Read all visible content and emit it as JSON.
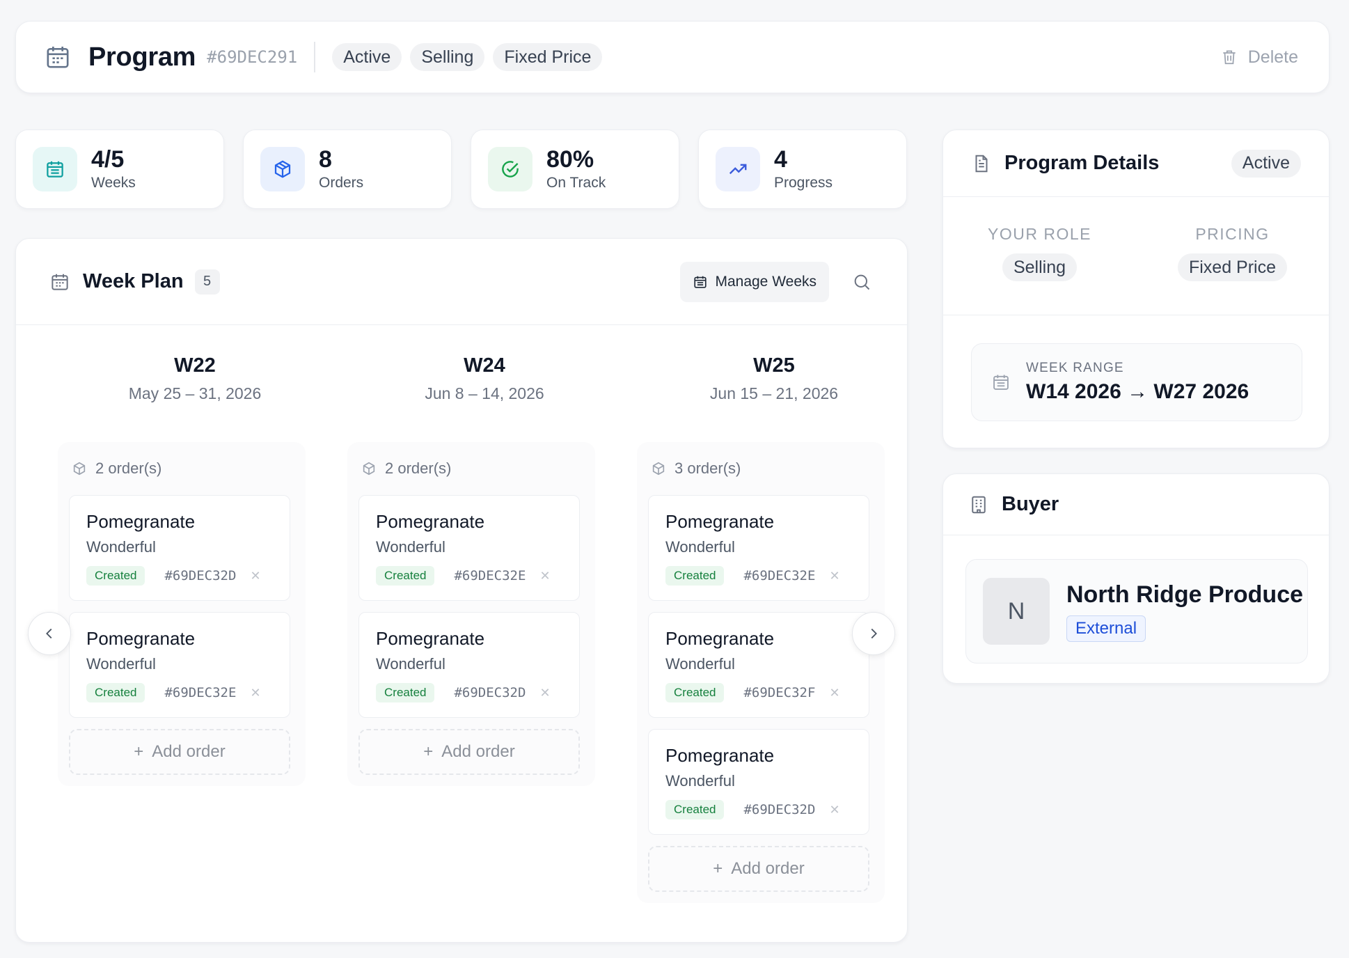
{
  "header": {
    "title": "Program",
    "code": "#69DEC291",
    "tags": [
      "Active",
      "Selling",
      "Fixed Price"
    ],
    "delete_label": "Delete"
  },
  "stats": [
    {
      "value": "4/5",
      "label": "Weeks",
      "icon": "calendar-icon",
      "color": "#0f9f9f",
      "bg": "#e6f7f6"
    },
    {
      "value": "8",
      "label": "Orders",
      "icon": "box-icon",
      "color": "#2563eb",
      "bg": "#e9f0fd"
    },
    {
      "value": "80%",
      "label": "On Track",
      "icon": "check-circle-icon",
      "color": "#16a34a",
      "bg": "#eaf7ee"
    },
    {
      "value": "4",
      "label": "Progress",
      "icon": "trending-up-icon",
      "color": "#3b5bdb",
      "bg": "#edf1fd"
    }
  ],
  "week_plan": {
    "title": "Week Plan",
    "count": "5",
    "manage_label": "Manage Weeks",
    "add_label": "Add order",
    "weeks": [
      {
        "week": "W22",
        "dates": "May 25 – 31, 2026",
        "order_count": "2 order(s)",
        "orders": [
          {
            "product": "Pomegranate",
            "variety": "Wonderful",
            "status": "Created",
            "id": "#69DEC32D"
          },
          {
            "product": "Pomegranate",
            "variety": "Wonderful",
            "status": "Created",
            "id": "#69DEC32E"
          }
        ]
      },
      {
        "week": "W24",
        "dates": "Jun 8 – 14, 2026",
        "order_count": "2 order(s)",
        "orders": [
          {
            "product": "Pomegranate",
            "variety": "Wonderful",
            "status": "Created",
            "id": "#69DEC32E"
          },
          {
            "product": "Pomegranate",
            "variety": "Wonderful",
            "status": "Created",
            "id": "#69DEC32D"
          }
        ]
      },
      {
        "week": "W25",
        "dates": "Jun 15 – 21, 2026",
        "order_count": "3 order(s)",
        "orders": [
          {
            "product": "Pomegranate",
            "variety": "Wonderful",
            "status": "Created",
            "id": "#69DEC32E"
          },
          {
            "product": "Pomegranate",
            "variety": "Wonderful",
            "status": "Created",
            "id": "#69DEC32F"
          },
          {
            "product": "Pomegranate",
            "variety": "Wonderful",
            "status": "Created",
            "id": "#69DEC32D"
          }
        ]
      }
    ]
  },
  "program_details": {
    "title": "Program Details",
    "status": "Active",
    "role_key": "YOUR ROLE",
    "role_value": "Selling",
    "pricing_key": "PRICING",
    "pricing_value": "Fixed Price",
    "range_key": "WEEK RANGE",
    "range_value": "W14 2026 → W27 2026"
  },
  "buyer": {
    "title": "Buyer",
    "initial": "N",
    "name": "North Ridge Produce",
    "type": "External"
  }
}
